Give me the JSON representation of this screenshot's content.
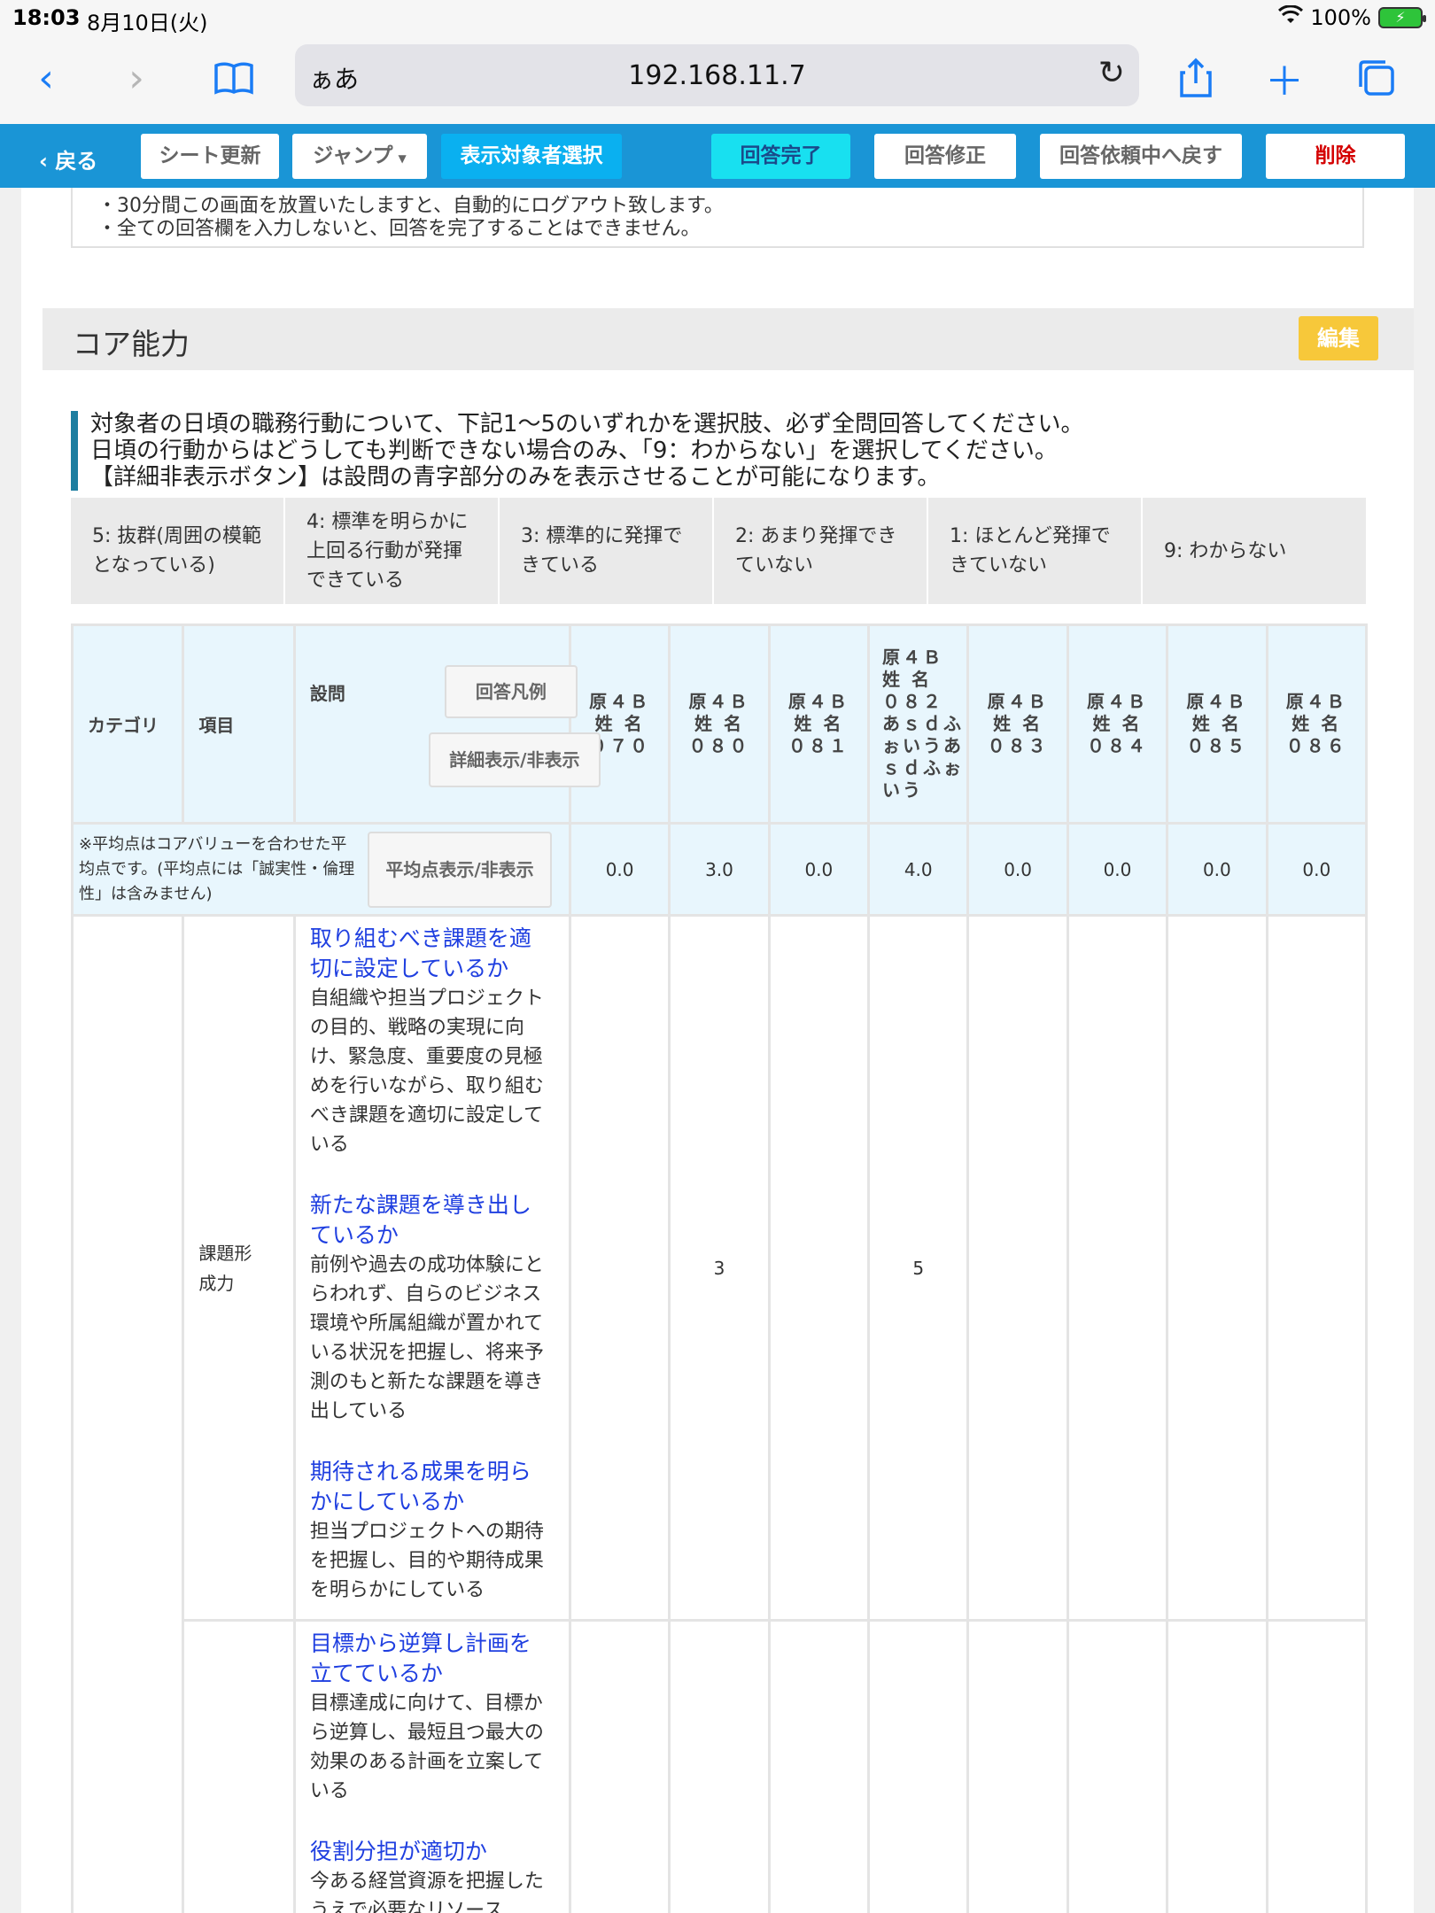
{
  "status_bar": {
    "time": "18:03",
    "date": "8月10日(火)",
    "battery": "100%"
  },
  "browser": {
    "aa_label": "ぁあ",
    "url": "192.168.11.7"
  },
  "toolbar": {
    "back": "戻る",
    "refresh": "シート更新",
    "jump": "ジャンプ",
    "select_target": "表示対象者選択",
    "complete": "回答完了",
    "revise": "回答修正",
    "return_request": "回答依頼中へ戻す",
    "delete": "削除"
  },
  "notice": {
    "partial_line": "・30分間この画面を放置いたしますと、自動的にログアウト致します。",
    "line2": "・全ての回答欄を入力しないと、回答を完了することはできません。"
  },
  "section": {
    "title": "コア能力",
    "edit": "編集"
  },
  "description": [
    "対象者の日頃の職務行動について、下記1〜5のいずれかを選択肢、必ず全問回答してください。",
    "日頃の行動からはどうしても判断できない場合のみ、「9：わからない」を選択してください。",
    "【詳細非表示ボタン】は設問の青字部分のみを表示させることが可能になります。"
  ],
  "legend": [
    "5: 抜群(周囲の模範となっている)",
    "4: 標準を明らかに上回る行動が発揮できている",
    "3: 標準的に発揮できている",
    "2: あまり発揮できていない",
    "1: ほとんど発揮できていない",
    "9: わからない"
  ],
  "table": {
    "col_category": "カテゴリ",
    "col_item": "項目",
    "col_question": "設問",
    "btn_legend": "回答凡例",
    "btn_detail": "詳細表示/非表示",
    "btn_avg": "平均点表示/非表示",
    "avg_note": "※平均点はコアバリューを合わせた平均点です。(平均点には「誠実性・倫理性」は含みません)",
    "people": [
      {
        "line1": "原４Ｂ",
        "line2": "姓 名",
        "line3": "０７０"
      },
      {
        "line1": "原４Ｂ",
        "line2": "姓 名",
        "line3": "０８０"
      },
      {
        "line1": "原４Ｂ",
        "line2": "姓 名",
        "line3": "０８１"
      },
      {
        "line1": "原４Ｂ",
        "line2": "姓 名",
        "line3": "０８２ あｓｄふぉいうあｓｄふぉいう"
      },
      {
        "line1": "原４Ｂ",
        "line2": "姓 名",
        "line3": "０８３"
      },
      {
        "line1": "原４Ｂ",
        "line2": "姓 名",
        "line3": "０８４"
      },
      {
        "line1": "原４Ｂ",
        "line2": "姓 名",
        "line3": "０８５"
      },
      {
        "line1": "原４Ｂ",
        "line2": "姓 名",
        "line3": "０８６"
      }
    ],
    "averages": [
      "0.0",
      "3.0",
      "0.0",
      "4.0",
      "0.0",
      "0.0",
      "0.0",
      "0.0"
    ],
    "rows": [
      {
        "item": "課題形成力",
        "questions": [
          {
            "title": "取り組むべき課題を適切に設定しているか",
            "body": "自組織や担当プロジェクトの目的、戦略の実現に向け、緊急度、重要度の見極めを行いながら、取り組むべき課題を適切に設定している"
          },
          {
            "title": "新たな課題を導き出しているか",
            "body": "前例や過去の成功体験にとらわれず、自らのビジネス環境や所属組織が置かれている状況を把握し、将来予測のもと新たな課題を導き出している"
          },
          {
            "title": "期待される成果を明らかにしているか",
            "body": "担当プロジェクトへの期待を把握し、目的や期待成果を明らかにしている"
          }
        ],
        "answers": [
          "",
          "3",
          "",
          "5",
          "",
          "",
          "",
          ""
        ]
      },
      {
        "item": "",
        "questions": [
          {
            "title": "目標から逆算し計画を立てているか",
            "body": "目標達成に向けて、目標から逆算し、最短且つ最大の効果のある計画を立案している"
          },
          {
            "title": "役割分担が適切か",
            "body": "今ある経営資源を把握したうえで必要なリソース"
          }
        ],
        "answers": [
          "",
          "",
          "",
          "",
          "",
          "",
          "",
          ""
        ]
      }
    ]
  }
}
